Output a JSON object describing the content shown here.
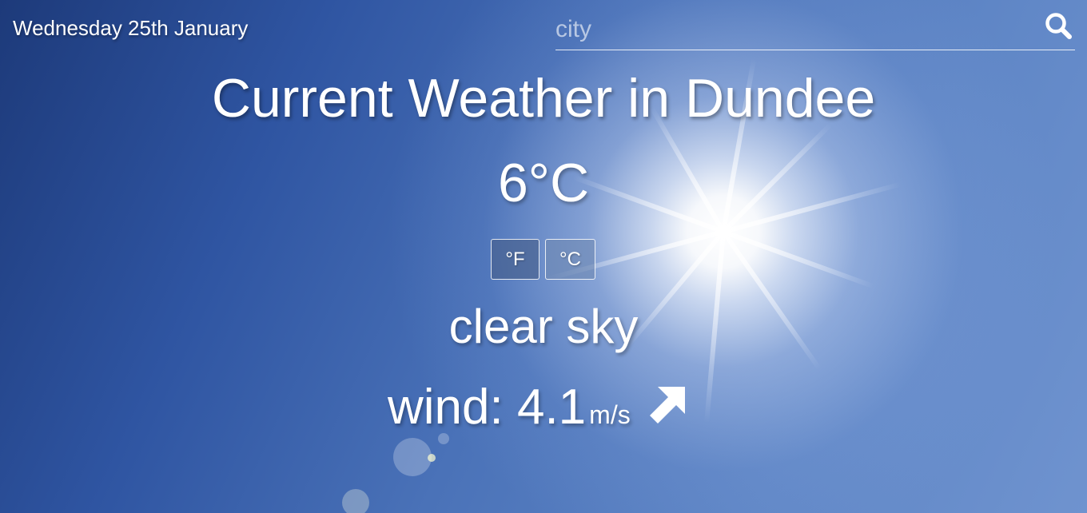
{
  "header": {
    "date": "Wednesday 25th January"
  },
  "search": {
    "placeholder": "city",
    "value": "",
    "icon": "search-icon"
  },
  "weather": {
    "title": "Current Weather in Dundee",
    "temperature": "6°C",
    "units": {
      "fahrenheit_label": "°F",
      "celsius_label": "°C"
    },
    "description": "clear sky",
    "wind": {
      "label": "wind: 4.1",
      "unit": "m/s",
      "direction_icon": "arrow-up-right-icon"
    }
  },
  "colors": {
    "sky_dark": "#1d3a7a",
    "sky_light": "#6f93cf",
    "text": "#ffffff"
  }
}
